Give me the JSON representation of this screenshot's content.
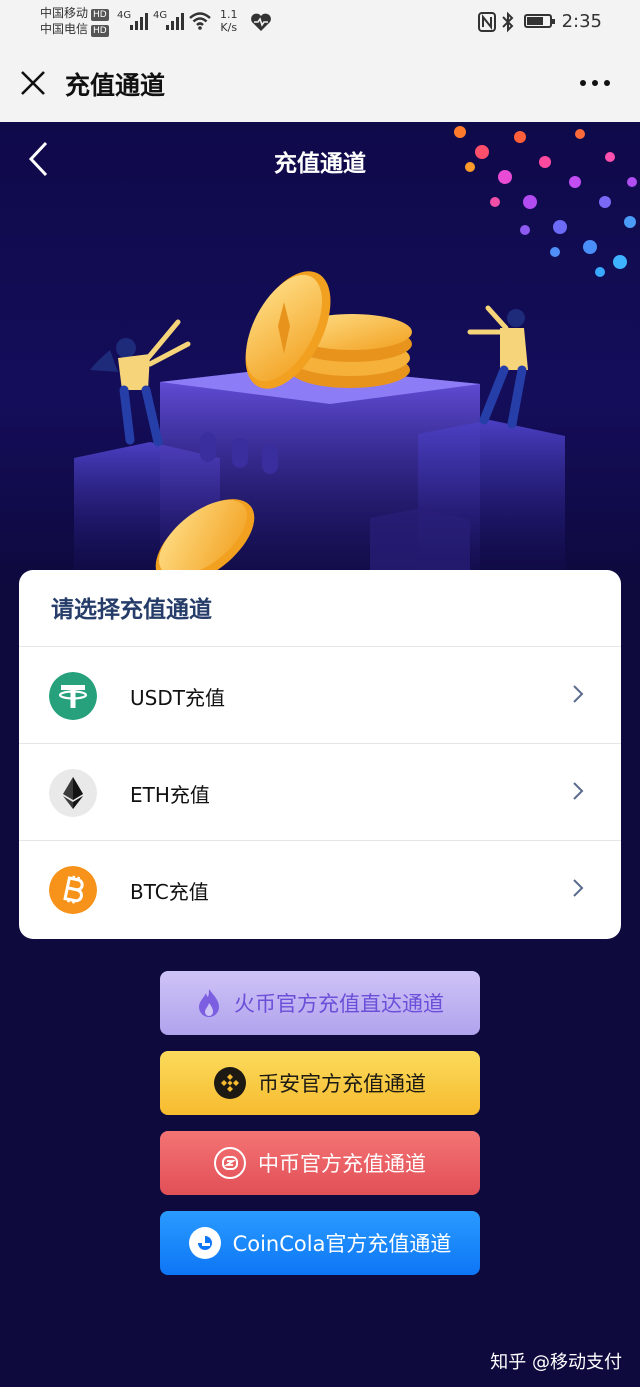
{
  "status_bar": {
    "carrier1": "中国移动",
    "carrier2": "中国电信",
    "hd": "HD",
    "net1": "4G",
    "net2": "4G",
    "speed_value": "1.1",
    "speed_unit": "K/s",
    "time": "2:35"
  },
  "nav": {
    "title": "充值通道"
  },
  "hero": {
    "title": "充值通道"
  },
  "channel_card": {
    "heading": "请选择充值通道",
    "items": [
      {
        "label": "USDT充值",
        "icon": "tether-icon",
        "color": "#26a17b"
      },
      {
        "label": "ETH充值",
        "icon": "ethereum-icon",
        "color": "#e9e9e9"
      },
      {
        "label": "BTC充值",
        "icon": "bitcoin-icon",
        "color": "#f7931a"
      }
    ]
  },
  "buttons": [
    {
      "label": "火币官方充值直达通道",
      "icon": "huobi-flame-icon"
    },
    {
      "label": "币安官方充值通道",
      "icon": "binance-icon"
    },
    {
      "label": "中币官方充值通道",
      "icon": "zb-icon"
    },
    {
      "label": "CoinCola官方充值通道",
      "icon": "coincola-icon"
    }
  ],
  "watermark": "知乎 @移动支付",
  "colors": {
    "background": "#0e0a3e",
    "card_heading": "#263d6a",
    "huobi": "#b0a3ee",
    "binance": "#f7bb2f",
    "zb": "#e14f57",
    "coincola": "#0d76f6"
  }
}
